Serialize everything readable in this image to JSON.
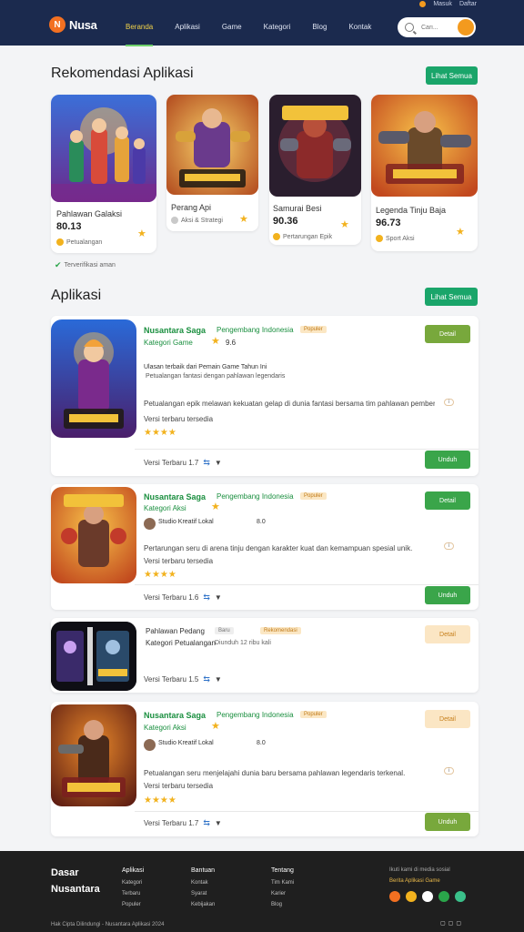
{
  "header": {
    "utility": [
      "Masuk",
      "Daftar"
    ],
    "logo_text": "Nusa",
    "nav": [
      "Beranda",
      "Aplikasi",
      "Game",
      "Kategori",
      "Blog",
      "Kontak"
    ],
    "search_placeholder": "Cari..."
  },
  "featured": {
    "title": "Rekomendasi Aplikasi",
    "button": "Lihat Semua",
    "cards": [
      {
        "title": "Pahlawan Galaksi",
        "score": "80.13",
        "meta": "Petualangan"
      },
      {
        "title": "Perang Api",
        "meta": "Aksi & Strategi"
      },
      {
        "title": "Samurai Besi",
        "score": "90.36",
        "meta": "Pertarungan Epik"
      },
      {
        "title": "Legenda Tinju Baja",
        "score": "96.73",
        "meta": "Sport Aksi"
      }
    ],
    "footnote": "Terverifikasi aman"
  },
  "apps": {
    "title": "Aplikasi",
    "button": "Lihat Semua",
    "items": [
      {
        "name": "Nusantara Saga",
        "developer": "Pengembang Indonesia",
        "tag": "Populer",
        "sub": "Kategori Game",
        "score": "9.6",
        "line1": "Ulasan terbaik dari Pemain Game Tahun Ini",
        "line2": "Petualangan fantasi dengan pahlawan legendaris",
        "desc": "Petualangan epik melawan kekuatan gelap di dunia fantasi bersama tim pahlawan pemberani.",
        "desc2": "Versi terbaru tersedia",
        "rating": "★★★★",
        "footer": "Versi Terbaru 1.7",
        "top_btn": "Detail",
        "bottom_btn": "Unduh"
      },
      {
        "name": "Nusantara Saga",
        "developer": "Pengembang Indonesia",
        "tag": "Populer",
        "sub": "Kategori Aksi",
        "author": "Studio Kreatif Lokal",
        "score": "8.0",
        "desc": "Pertarungan seru di arena tinju dengan karakter kuat dan kemampuan spesial unik.",
        "desc2": "Versi terbaru tersedia",
        "rating": "★★★★",
        "footer": "Versi Terbaru 1.6",
        "top_btn": "Detail",
        "bottom_btn": "Unduh"
      },
      {
        "name": "Pahlawan Pedang",
        "sub": "Kategori Petualangan",
        "tag": "Baru",
        "tag2": "Rekomendasi",
        "stat": "Diunduh 12 ribu kali",
        "footer": "Versi Terbaru 1.5",
        "top_btn": "Detail"
      },
      {
        "name": "Nusantara Saga",
        "developer": "Pengembang Indonesia",
        "tag": "Populer",
        "sub": "Kategori Aksi",
        "author": "Studio Kreatif Lokal",
        "score": "8.0",
        "desc": "Petualangan seru menjelajahi dunia baru bersama pahlawan legendaris terkenal.",
        "desc2": "Versi terbaru tersedia",
        "rating": "★★★★",
        "footer": "Versi Terbaru 1.7",
        "top_btn": "Detail",
        "bottom_btn": "Unduh"
      }
    ]
  },
  "footer": {
    "brand_line1": "Dasar",
    "brand_line2": "Nusantara",
    "cols": [
      {
        "h": "Aplikasi",
        "links": [
          "Kategori",
          "Terbaru",
          "Populer"
        ]
      },
      {
        "h": "Bantuan",
        "links": [
          "Kontak",
          "Syarat",
          "Kebijakan"
        ]
      },
      {
        "h": "Tentang",
        "links": [
          "Tim Kami",
          "Karier",
          "Blog"
        ]
      }
    ],
    "newsletter": "Ikuti kami di media sosial",
    "note_links": "Berita Aplikasi Game",
    "copyright": "Hak Cipta Dilindungi - Nusantara Aplikasi 2024"
  },
  "colors": {
    "header_bg": "#1b2a4e",
    "accent_green": "#1aa56a",
    "accent_orange": "#f39a1e",
    "footer_bg": "#1f1f1f"
  }
}
